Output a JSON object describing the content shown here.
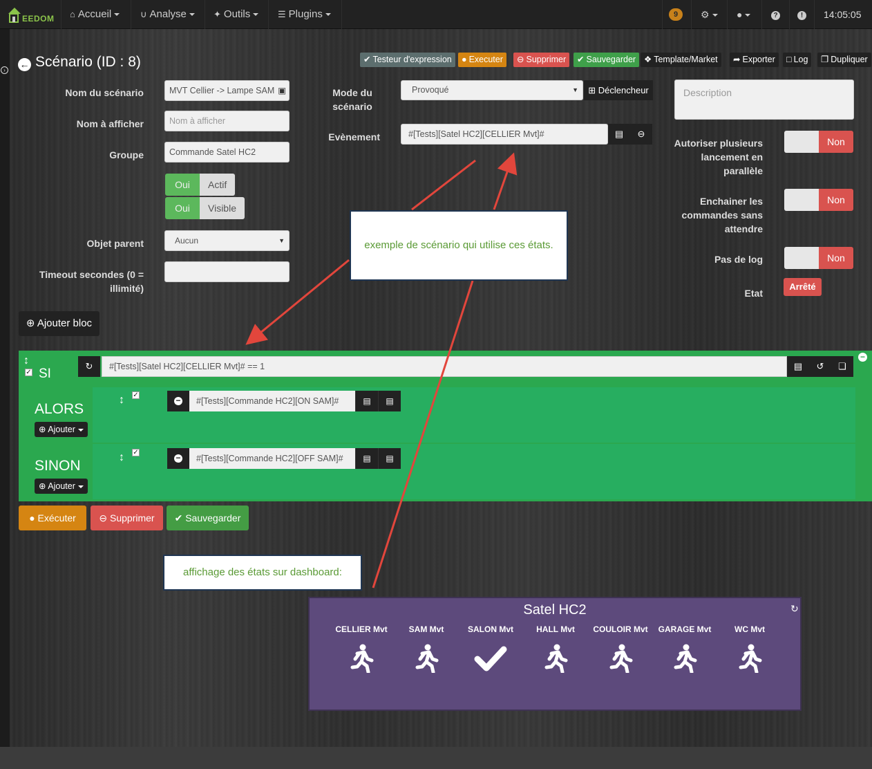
{
  "navbar": {
    "brand": "EEDOM",
    "menus": [
      {
        "label": "Accueil",
        "icon": "home-icon"
      },
      {
        "label": "Analyse",
        "icon": "stethoscope-icon"
      },
      {
        "label": "Outils",
        "icon": "wrench-icon"
      },
      {
        "label": "Plugins",
        "icon": "list-icon"
      }
    ],
    "messages_count": "9",
    "time": "14:05:05"
  },
  "page": {
    "title": "Scénario (ID : 8)"
  },
  "toolbar": {
    "tester": "Testeur d'expression",
    "execute": "Executer",
    "delete": "Supprimer",
    "save": "Sauvegarder",
    "template": "Template/Market",
    "export": "Exporter",
    "log": "Log",
    "duplicate": "Dupliquer"
  },
  "form": {
    "name_label": "Nom du scénario",
    "name_value": "MVT Cellier -> Lampe SAM",
    "display_label": "Nom à afficher",
    "display_placeholder": "Nom à afficher",
    "group_label": "Groupe",
    "group_value": "Commande Satel HC2",
    "active_on": "Oui",
    "active_label": "Actif",
    "visible_on": "Oui",
    "visible_label": "Visible",
    "parent_label": "Objet parent",
    "parent_value": "Aucun",
    "timeout_label_1": "Timeout secondes (0 =",
    "timeout_label_2": "illimité)",
    "mode_label_1": "Mode du",
    "mode_label_2": "scénario",
    "mode_value": "Provoqué",
    "trigger_button": "Déclencheur",
    "event_label": "Evènement",
    "event_value": "#[Tests][Satel HC2][CELLIER Mvt]#",
    "description_placeholder": "Description",
    "parallel_label_1": "Autoriser plusieurs",
    "parallel_label_2": "lancement en",
    "parallel_label_3": "parallèle",
    "chain_label_1": "Enchainer les",
    "chain_label_2": "commandes sans",
    "chain_label_3": "attendre",
    "nolog_label": "Pas de log",
    "no_value": "Non",
    "state_label": "Etat",
    "state_value": "Arrêté"
  },
  "add_block": "Ajouter bloc",
  "block": {
    "if_label": "SI",
    "condition": "#[Tests][Satel HC2][CELLIER Mvt]# == 1",
    "then_label": "ALORS",
    "else_label": "SINON",
    "add_label": "Ajouter",
    "then_command": "#[Tests][Commande HC2][ON SAM]#",
    "else_command": "#[Tests][Commande HC2][OFF SAM]#"
  },
  "bottom_buttons": {
    "execute": "Exécuter",
    "delete": "Supprimer",
    "save": "Sauvegarder"
  },
  "callouts": {
    "scenario_note": "exemple de scénario qui utilise ces états.",
    "dashboard_note": "affichage des états sur dashboard:"
  },
  "widget": {
    "title": "Satel HC2",
    "sensors": [
      {
        "name": "CELLIER Mvt",
        "state": "walking-icon"
      },
      {
        "name": "SAM Mvt",
        "state": "walking-icon"
      },
      {
        "name": "SALON Mvt",
        "state": "check-icon"
      },
      {
        "name": "HALL Mvt",
        "state": "walking-icon"
      },
      {
        "name": "COULOIR Mvt",
        "state": "walking-icon"
      },
      {
        "name": "GARAGE Mvt",
        "state": "walking-icon"
      },
      {
        "name": "WC Mvt",
        "state": "walking-icon"
      }
    ]
  },
  "colors": {
    "block_green": "#2ba84f",
    "danger": "#d9534f",
    "warning": "#d58512",
    "widget_purple": "#5d4a7c",
    "annotation_arrow": "#e2463c"
  }
}
